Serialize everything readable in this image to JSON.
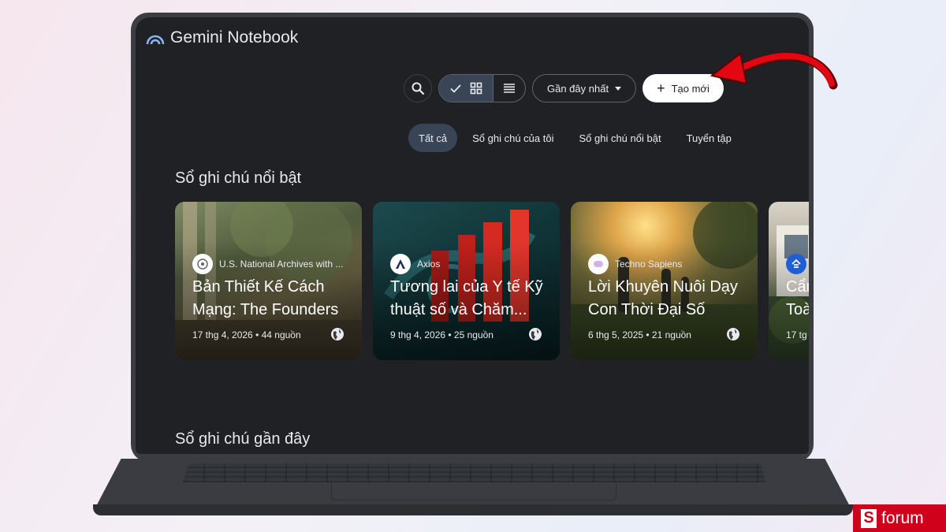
{
  "app": {
    "title": "Gemini Notebook"
  },
  "toolbar": {
    "sort_label": "Gần đây nhất",
    "create_label": "Tạo mới"
  },
  "filters": [
    "Tất cả",
    "Sổ ghi chú của tôi",
    "Sổ ghi chú nổi bật",
    "Tuyển tập"
  ],
  "sections": {
    "featured_title": "Sổ ghi chú nổi bật",
    "recent_title": "Sổ ghi chú gần đây"
  },
  "cards": [
    {
      "source": "U.S. National Archives with ...",
      "title": "Bản Thiết Kế Cách Mạng: The Founders",
      "meta": "17 thg 4, 2026 • 44 nguồn"
    },
    {
      "source": "Axios",
      "title": "Tương lai của Y tế Kỹ thuật số và Chăm...",
      "meta": "9 thg 4, 2026 • 25 nguồn"
    },
    {
      "source": "Techno Sapiens",
      "title": "Lời Khuyên Nuôi Dạy Con Thời Đại Số",
      "meta": "6 thg 5, 2025 • 21 nguồn"
    },
    {
      "source": "",
      "title": "Cẩm Toà",
      "meta": "17 tg"
    }
  ],
  "watermark": {
    "text": "forum",
    "letter": "S"
  },
  "colors": {
    "accent_chip": "#394457",
    "screen_bg": "#202124",
    "arrow": "#e30613"
  }
}
